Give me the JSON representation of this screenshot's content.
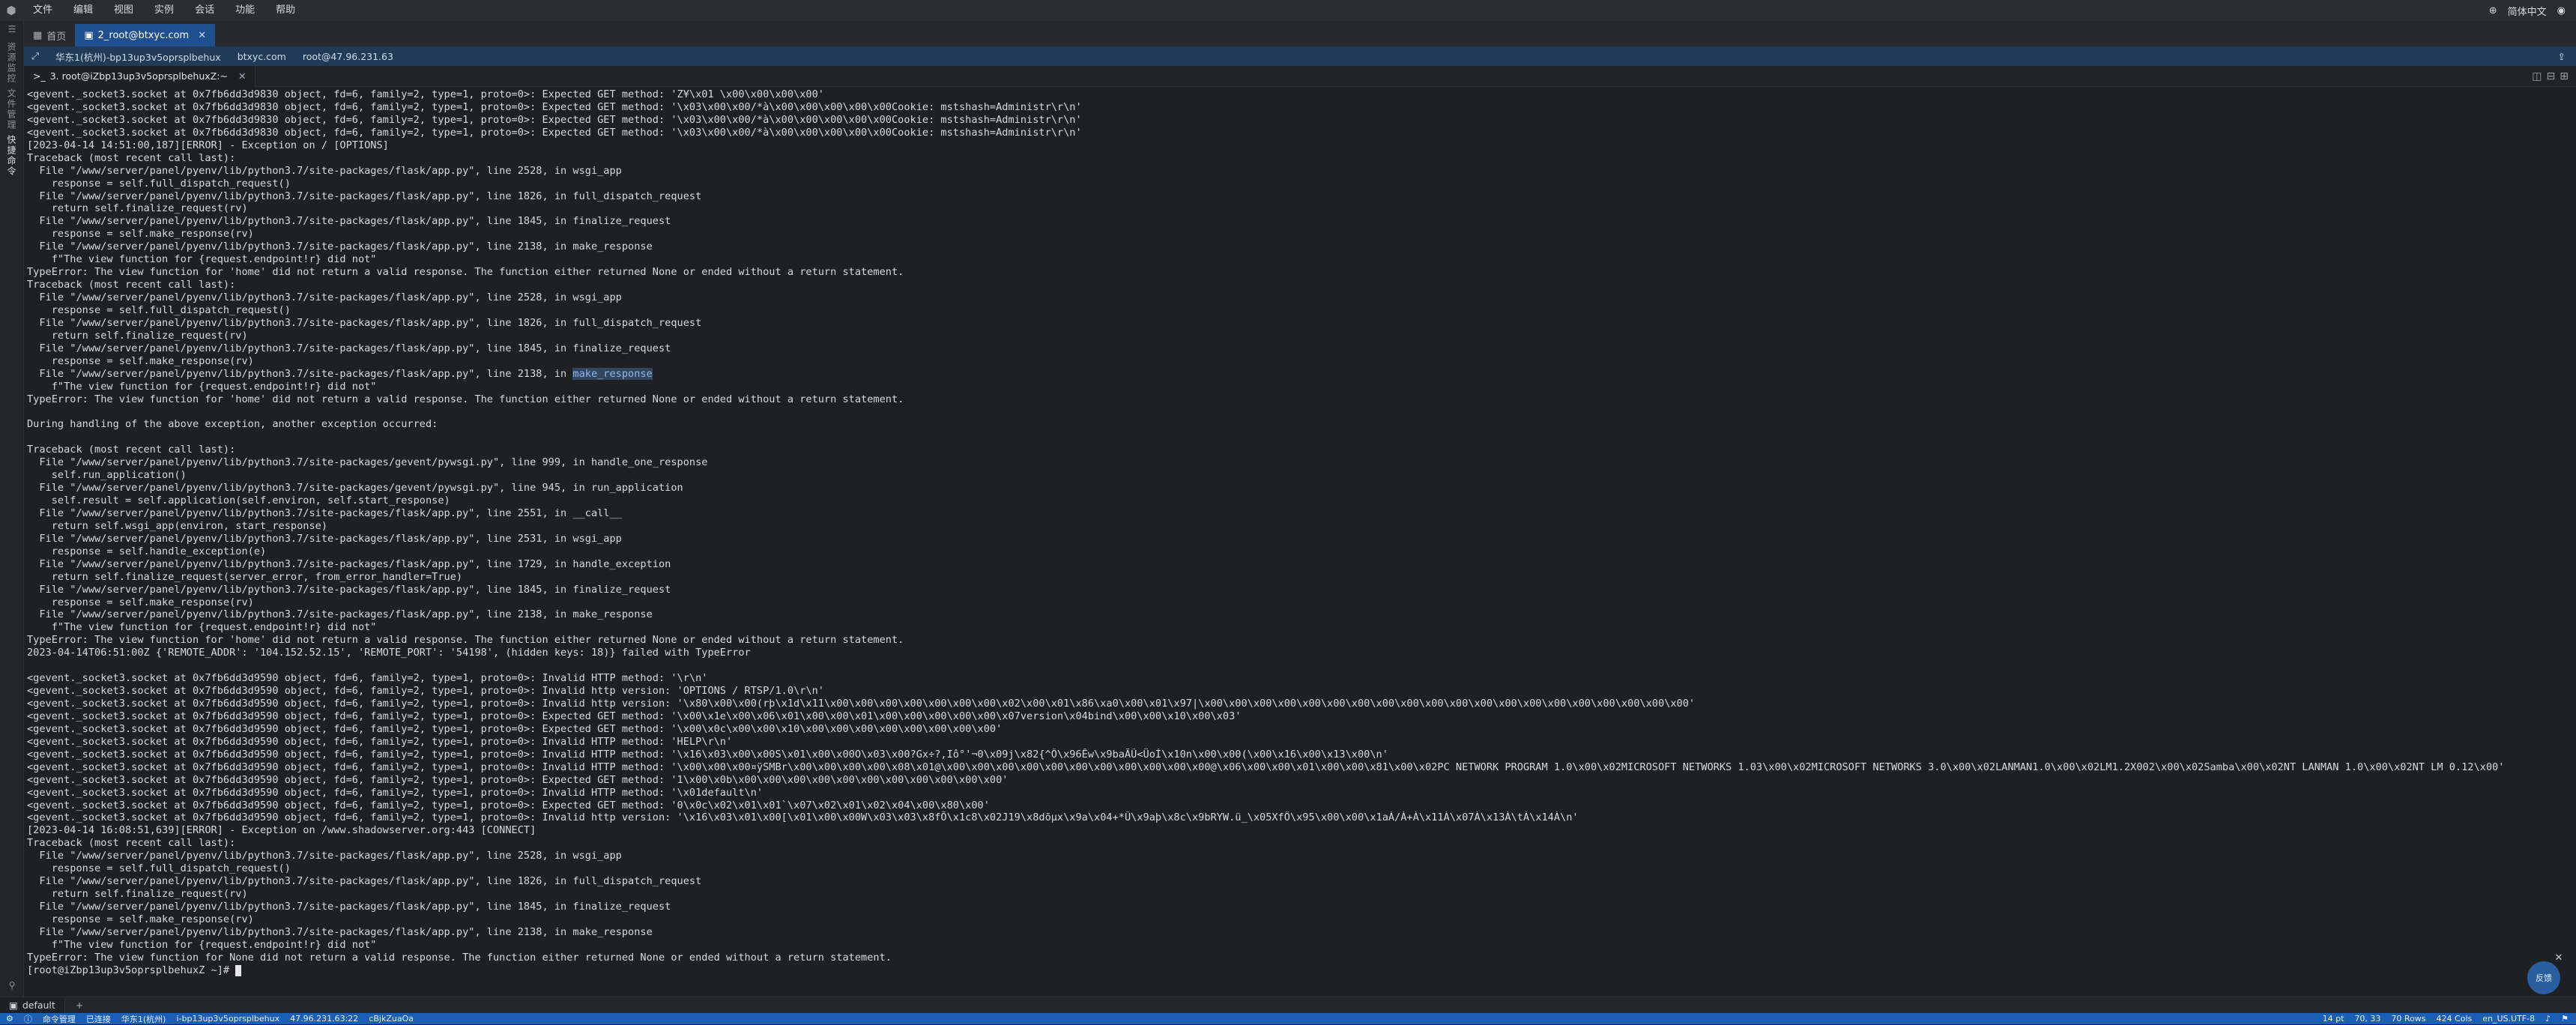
{
  "menubar": {
    "items": [
      "文件",
      "编辑",
      "视图",
      "实例",
      "会话",
      "功能",
      "帮助"
    ],
    "language": "简体中文"
  },
  "leftstrip": {
    "labels": [
      "资源监控",
      "文件管理",
      "快捷命令"
    ]
  },
  "tabs": [
    {
      "label": "首页",
      "active": false
    },
    {
      "label": "2_root@btxyc.com",
      "active": true
    }
  ],
  "toolbar": {
    "region": "华东1(杭州)-bp13up3v5oprsplbehux",
    "host": "btxyc.com",
    "user_ip": "root@47.96.231.63"
  },
  "subtab": {
    "label": "3. root@iZbp13up3v5oprsplbehuxZ:~"
  },
  "terminal": {
    "lines": [
      "<gevent._socket3.socket at 0x7fb6dd3d9830 object, fd=6, family=2, type=1, proto=0>: Expected GET method: 'Z¥\\x01 \\x00\\x00\\x00\\x00'",
      "<gevent._socket3.socket at 0x7fb6dd3d9830 object, fd=6, family=2, type=1, proto=0>: Expected GET method: '\\x03\\x00\\x00/*à\\x00\\x00\\x00\\x00\\x00Cookie: mstshash=Administr\\r\\n'",
      "<gevent._socket3.socket at 0x7fb6dd3d9830 object, fd=6, family=2, type=1, proto=0>: Expected GET method: '\\x03\\x00\\x00/*à\\x00\\x00\\x00\\x00\\x00Cookie: mstshash=Administr\\r\\n'",
      "<gevent._socket3.socket at 0x7fb6dd3d9830 object, fd=6, family=2, type=1, proto=0>: Expected GET method: '\\x03\\x00\\x00/*à\\x00\\x00\\x00\\x00\\x00Cookie: mstshash=Administr\\r\\n'",
      "[2023-04-14 14:51:00,187][ERROR] - Exception on / [OPTIONS]",
      "Traceback (most recent call last):",
      "  File \"/www/server/panel/pyenv/lib/python3.7/site-packages/flask/app.py\", line 2528, in wsgi_app",
      "    response = self.full_dispatch_request()",
      "  File \"/www/server/panel/pyenv/lib/python3.7/site-packages/flask/app.py\", line 1826, in full_dispatch_request",
      "    return self.finalize_request(rv)",
      "  File \"/www/server/panel/pyenv/lib/python3.7/site-packages/flask/app.py\", line 1845, in finalize_request",
      "    response = self.make_response(rv)",
      "  File \"/www/server/panel/pyenv/lib/python3.7/site-packages/flask/app.py\", line 2138, in make_response",
      "    f\"The view function for {request.endpoint!r} did not\"",
      "TypeError: The view function for 'home' did not return a valid response. The function either returned None or ended without a return statement.",
      "Traceback (most recent call last):",
      "  File \"/www/server/panel/pyenv/lib/python3.7/site-packages/flask/app.py\", line 2528, in wsgi_app",
      "    response = self.full_dispatch_request()",
      "  File \"/www/server/panel/pyenv/lib/python3.7/site-packages/flask/app.py\", line 1826, in full_dispatch_request",
      "    return self.finalize_request(rv)",
      "  File \"/www/server/panel/pyenv/lib/python3.7/site-packages/flask/app.py\", line 1845, in finalize_request",
      "    response = self.make_response(rv)",
      "  File \"/www/server/panel/pyenv/lib/python3.7/site-packages/flask/app.py\", line 2138, in ",
      "    f\"The view function for {request.endpoint!r} did not\"",
      "TypeError: The view function for 'home' did not return a valid response. The function either returned None or ended without a return statement.",
      "",
      "During handling of the above exception, another exception occurred:",
      "",
      "Traceback (most recent call last):",
      "  File \"/www/server/panel/pyenv/lib/python3.7/site-packages/gevent/pywsgi.py\", line 999, in handle_one_response",
      "    self.run_application()",
      "  File \"/www/server/panel/pyenv/lib/python3.7/site-packages/gevent/pywsgi.py\", line 945, in run_application",
      "    self.result = self.application(self.environ, self.start_response)",
      "  File \"/www/server/panel/pyenv/lib/python3.7/site-packages/flask/app.py\", line 2551, in __call__",
      "    return self.wsgi_app(environ, start_response)",
      "  File \"/www/server/panel/pyenv/lib/python3.7/site-packages/flask/app.py\", line 2531, in wsgi_app",
      "    response = self.handle_exception(e)",
      "  File \"/www/server/panel/pyenv/lib/python3.7/site-packages/flask/app.py\", line 1729, in handle_exception",
      "    return self.finalize_request(server_error, from_error_handler=True)",
      "  File \"/www/server/panel/pyenv/lib/python3.7/site-packages/flask/app.py\", line 1845, in finalize_request",
      "    response = self.make_response(rv)",
      "  File \"/www/server/panel/pyenv/lib/python3.7/site-packages/flask/app.py\", line 2138, in make_response",
      "    f\"The view function for {request.endpoint!r} did not\"",
      "TypeError: The view function for 'home' did not return a valid response. The function either returned None or ended without a return statement.",
      "2023-04-14T06:51:00Z {'REMOTE_ADDR': '104.152.52.15', 'REMOTE_PORT': '54198', (hidden keys: 18)} failed with TypeError",
      "",
      "<gevent._socket3.socket at 0x7fb6dd3d9590 object, fd=6, family=2, type=1, proto=0>: Invalid HTTP method: '\\r\\n'",
      "<gevent._socket3.socket at 0x7fb6dd3d9590 object, fd=6, family=2, type=1, proto=0>: Invalid http version: 'OPTIONS / RTSP/1.0\\r\\n'",
      "<gevent._socket3.socket at 0x7fb6dd3d9590 object, fd=6, family=2, type=1, proto=0>: Invalid http version: '\\x80\\x00\\x00(rþ\\x1d\\x11\\x00\\x00\\x00\\x00\\x00\\x00\\x00\\x02\\x00\\x01\\x86\\xa0\\x00\\x01\\x97|\\x00\\x00\\x00\\x00\\x00\\x00\\x00\\x00\\x00\\x00\\x00\\x00\\x00\\x00\\x00\\x00\\x00\\x00\\x00\\x00'",
      "<gevent._socket3.socket at 0x7fb6dd3d9590 object, fd=6, family=2, type=1, proto=0>: Expected GET method: '\\x00\\x1e\\x00\\x06\\x01\\x00\\x00\\x01\\x00\\x00\\x00\\x00\\x00\\x07version\\x04bind\\x00\\x00\\x10\\x00\\x03'",
      "<gevent._socket3.socket at 0x7fb6dd3d9590 object, fd=6, family=2, type=1, proto=0>: Expected GET method: '\\x00\\x0c\\x00\\x00\\x10\\x00\\x00\\x00\\x00\\x00\\x00\\x00\\x00'",
      "<gevent._socket3.socket at 0x7fb6dd3d9590 object, fd=6, family=2, type=1, proto=0>: Invalid HTTP method: 'HELP\\r\\n'",
      "<gevent._socket3.socket at 0x7fb6dd3d9590 object, fd=6, family=2, type=1, proto=0>: Invalid HTTP method: '\\x16\\x03\\x00\\x00S\\x01\\x00\\x00O\\x03\\x00?Gx÷?,Iô°'¬0\\x09j\\x82{^Ô\\x96Êw\\x9baÃÛ<ÜoÍ\\x10n\\x00\\x00(\\x00\\x16\\x00\\x13\\x00\\n'",
      "<gevent._socket3.socket at 0x7fb6dd3d9590 object, fd=6, family=2, type=1, proto=0>: Invalid HTTP method: '\\x00\\x00\\x00¤ÿSMBr\\x00\\x00\\x00\\x00\\x08\\x01@\\x00\\x00\\x00\\x00\\x00\\x00\\x00\\x00\\x00\\x00\\x00@\\x06\\x00\\x00\\x01\\x00\\x00\\x81\\x00\\x02PC NETWORK PROGRAM 1.0\\x00\\x02MICROSOFT NETWORKS 1.03\\x00\\x02MICROSOFT NETWORKS 3.0\\x00\\x02LANMAN1.0\\x00\\x02LM1.2X002\\x00\\x02Samba\\x00\\x02NT LANMAN 1.0\\x00\\x02NT LM 0.12\\x00'",
      "<gevent._socket3.socket at 0x7fb6dd3d9590 object, fd=6, family=2, type=1, proto=0>: Expected GET method: '1\\x00\\x0b\\x00\\x00\\x00\\x00\\x00\\x00\\x00\\x00\\x00\\x00\\x00'",
      "<gevent._socket3.socket at 0x7fb6dd3d9590 object, fd=6, family=2, type=1, proto=0>: Invalid HTTP method: '\\x01default\\n'",
      "<gevent._socket3.socket at 0x7fb6dd3d9590 object, fd=6, family=2, type=1, proto=0>: Expected GET method: '0\\x0c\\x02\\x01\\x01`\\x07\\x02\\x01\\x02\\x04\\x00\\x80\\x00'",
      "<gevent._socket3.socket at 0x7fb6dd3d9590 object, fd=6, family=2, type=1, proto=0>: Invalid http version: '\\x16\\x03\\x01\\x00[\\x01\\x00\\x00W\\x03\\x03\\x8fÕ\\x1c8\\x02J19\\x8dõµx\\x9a\\x04+*Û\\x9aþ\\x8c\\x9bRYW.ü_\\x05XfÖ\\x95\\x00\\x00\\x1aÀ/À+À\\x11À\\x07À\\x13À\\tÀ\\x14À\\n'",
      "[2023-04-14 16:08:51,639][ERROR] - Exception on /www.shadowserver.org:443 [CONNECT]",
      "Traceback (most recent call last):",
      "  File \"/www/server/panel/pyenv/lib/python3.7/site-packages/flask/app.py\", line 2528, in wsgi_app",
      "    response = self.full_dispatch_request()",
      "  File \"/www/server/panel/pyenv/lib/python3.7/site-packages/flask/app.py\", line 1826, in full_dispatch_request",
      "    return self.finalize_request(rv)",
      "  File \"/www/server/panel/pyenv/lib/python3.7/site-packages/flask/app.py\", line 1845, in finalize_request",
      "    response = self.make_response(rv)",
      "  File \"/www/server/panel/pyenv/lib/python3.7/site-packages/flask/app.py\", line 2138, in make_response",
      "    f\"The view function for {request.endpoint!r} did not\"",
      "TypeError: The view function for None did not return a valid response. The function either returned None or ended without a return statement."
    ],
    "highlight_line": 22,
    "highlight_text": "make_response",
    "prompt": "[root@iZbp13up3v5oprsplbehuxZ ~]# "
  },
  "session_tab": {
    "label": "default"
  },
  "statusbar": {
    "left": [
      "命令管理",
      "已连接",
      "华东1(杭州)",
      "i-bp13up3v5oprsplbehux",
      "47.96.231.63:22",
      "cBjkZuaOa"
    ],
    "right": [
      "14 pt",
      "70, 33",
      "70 Rows",
      "424 Cols",
      "en_US.UTF-8"
    ]
  },
  "float_button": {
    "label": "反馈"
  }
}
